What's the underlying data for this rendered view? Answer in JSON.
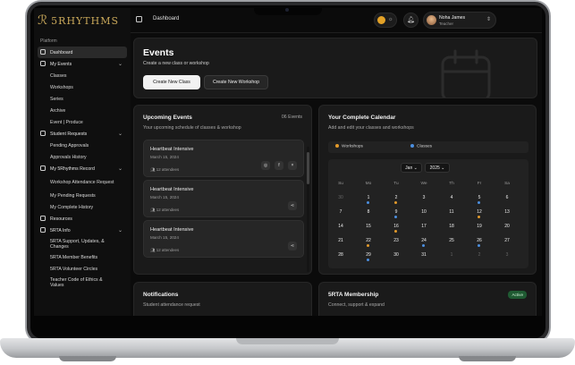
{
  "app": {
    "logo_text": "5RHYTHMS",
    "header_title": "Dashboard"
  },
  "user": {
    "name": "Noha James",
    "role": "Teacher"
  },
  "sidebar": {
    "section_label": "Platform",
    "items": [
      {
        "label": "Dashboard",
        "icon": "dashboard-icon",
        "type": "top",
        "active": true
      },
      {
        "label": "My Events",
        "icon": "calendar-icon",
        "type": "top",
        "expandable": true
      },
      {
        "label": "Classes",
        "type": "sub"
      },
      {
        "label": "Workshops",
        "type": "sub"
      },
      {
        "label": "Series",
        "type": "sub"
      },
      {
        "label": "Archive",
        "type": "sub"
      },
      {
        "label": "Event | Produce",
        "type": "sub"
      },
      {
        "label": "Student Requests",
        "icon": "requests-icon",
        "type": "top",
        "expandable": true
      },
      {
        "label": "Pending Approvals",
        "type": "sub"
      },
      {
        "label": "Approvals History",
        "type": "sub"
      },
      {
        "label": "My 5Rhythms Record",
        "icon": "record-icon",
        "type": "top",
        "expandable": true
      },
      {
        "label": "Workshop Attendance Request",
        "type": "sub"
      },
      {
        "label": "My Pending Requests",
        "type": "sub"
      },
      {
        "label": "My Complete History",
        "type": "sub"
      },
      {
        "label": "Resources",
        "icon": "resources-icon",
        "type": "top"
      },
      {
        "label": "5RTA Info",
        "icon": "info-icon",
        "type": "top",
        "expandable": true
      },
      {
        "label": "5RTA Support, Updates, & Changes",
        "type": "sub"
      },
      {
        "label": "5RTA Member Benefits",
        "type": "sub"
      },
      {
        "label": "5RTA Volunteer Circles",
        "type": "sub"
      },
      {
        "label": "Teacher Code of Ethics & Values",
        "type": "sub"
      }
    ]
  },
  "events_card": {
    "title": "Events",
    "subtitle": "Create a new class or workshop",
    "create_class": "Create New Class",
    "create_workshop": "Create New Workshop"
  },
  "upcoming": {
    "title": "Upcoming Events",
    "subtitle": "Your upcoming schedule of classes & workshop",
    "count": "06 Events",
    "items": [
      {
        "title": "Heartbeat Intensive",
        "date": "March 15, 2024",
        "attendees": "12 attendees"
      },
      {
        "title": "Heartbeat Intensive",
        "date": "March 15, 2024",
        "attendees": "12 attendees"
      },
      {
        "title": "Heartbeat Intensive",
        "date": "March 15, 2024",
        "attendees": "12 attendees"
      }
    ]
  },
  "calendar": {
    "title": "Your Complete Calendar",
    "subtitle": "Add and edit your classes and workshops",
    "legend": [
      {
        "label": "Workshops",
        "color": "#e39a2a"
      },
      {
        "label": "Classes",
        "color": "#4b8fe0"
      }
    ],
    "month": "Jan",
    "year": "2025",
    "weekdays": [
      "Su",
      "Mo",
      "Tu",
      "We",
      "Th",
      "Fr",
      "Sa"
    ],
    "weeks": [
      [
        {
          "d": "30",
          "m": true
        },
        {
          "d": "1",
          "dot": "#4b8fe0"
        },
        {
          "d": "2",
          "dot": "#e39a2a"
        },
        {
          "d": "3"
        },
        {
          "d": "4"
        },
        {
          "d": "5",
          "dot": "#4b8fe0"
        },
        {
          "d": "6"
        }
      ],
      [
        {
          "d": "7"
        },
        {
          "d": "8"
        },
        {
          "d": "9",
          "dot": "#4b8fe0"
        },
        {
          "d": "10"
        },
        {
          "d": "11"
        },
        {
          "d": "12",
          "dot": "#e39a2a"
        },
        {
          "d": "13"
        }
      ],
      [
        {
          "d": "14"
        },
        {
          "d": "15"
        },
        {
          "d": "16",
          "dot": "#e39a2a"
        },
        {
          "d": "17"
        },
        {
          "d": "18"
        },
        {
          "d": "19"
        },
        {
          "d": "20"
        }
      ],
      [
        {
          "d": "21"
        },
        {
          "d": "22",
          "dot": "#e39a2a"
        },
        {
          "d": "23"
        },
        {
          "d": "24",
          "dot": "#4b8fe0"
        },
        {
          "d": "25"
        },
        {
          "d": "26",
          "dot": "#4b8fe0"
        },
        {
          "d": "27"
        }
      ],
      [
        {
          "d": "28"
        },
        {
          "d": "29",
          "dot": "#4b8fe0"
        },
        {
          "d": "30"
        },
        {
          "d": "31"
        },
        {
          "d": "1",
          "m": true
        },
        {
          "d": "2",
          "m": true
        },
        {
          "d": "3",
          "m": true
        }
      ]
    ]
  },
  "notifications": {
    "title": "Notifications",
    "subtitle": "Student attendance request"
  },
  "membership": {
    "title": "5RTA Membership",
    "subtitle": "Connect, support & expand",
    "badge": "Active"
  }
}
